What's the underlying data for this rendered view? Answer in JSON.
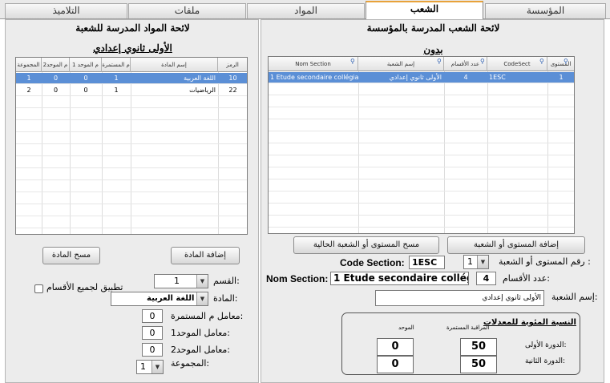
{
  "tabs": [
    {
      "label": "المؤسسة",
      "active": false
    },
    {
      "label": "الشعب",
      "active": true
    },
    {
      "label": "المواد",
      "active": false
    },
    {
      "label": "ملفات",
      "active": false
    },
    {
      "label": "التلاميذ",
      "active": false
    }
  ],
  "sections_panel": {
    "title": "لائحة الشعب المدرسة بالمؤسسة",
    "subtitle": "بدون",
    "columns": [
      "المستوى",
      "CodeSect",
      "عدد الأقسام",
      "إسم الشعبة",
      "Nom Section"
    ],
    "rows": [
      {
        "level": "1",
        "code": "1ESC",
        "count": "4",
        "name_ar": "الأولى ثانوي إعدادي",
        "name_fr": "1 Etude secondaire collégial"
      }
    ],
    "add_button": "إضافة المستوى أو الشعبة",
    "delete_button": "مسح المستوى أو الشعبة الحالية",
    "code_section_label": "Code Section:",
    "code_section_value": "1ESC",
    "level_label": "رقم المستوى أو الشعبة :",
    "level_value": "1",
    "nom_section_label": "Nom Section:",
    "nom_section_value": "1 Etude secondaire collégial",
    "classes_label": "عدد الأقسام:",
    "classes_value": "4",
    "name_label": "إسم الشعبة:",
    "name_value": "الأولى ثانوي إعدادي",
    "ratio_group": {
      "title": "النسبة المئوية للمعدلات",
      "col_continuous": "المراقبة المستمرة",
      "col_unified": "الموحد",
      "sem1_label": "الدورة الأولى:",
      "sem2_label": "الدورة الثانية:",
      "sem1_continuous": "50",
      "sem1_unified": "0",
      "sem2_continuous": "50",
      "sem2_unified": "0"
    }
  },
  "subjects_panel": {
    "title": "لائحة المواد المدرسة للشعبة",
    "subtitle": "الأولى ثانوي إعدادي",
    "columns": [
      "الرمز",
      "إسم المادة",
      "م المستمرة",
      "م الموحد 1",
      "م الموحد2",
      "المجموعة"
    ],
    "rows": [
      {
        "code": "10",
        "name": "اللغة العربية",
        "c1": "1",
        "c2": "0",
        "c3": "0",
        "group": "1"
      },
      {
        "code": "22",
        "name": "الرياضيات",
        "c1": "1",
        "c2": "0",
        "c3": "0",
        "group": "2"
      }
    ],
    "add_button": "إضافة المادة",
    "delete_button": "مسح المادة",
    "class_label": "القسم:",
    "class_value": "1",
    "apply_label": "تطبيق لجميع الأقسام",
    "subject_label": "المادة:",
    "subject_value": "اللغة العربية",
    "coef_continuous_label": "معامل م المستمرة:",
    "coef_continuous_value": "0",
    "coef_unified1_label": "معامل الموحد1:",
    "coef_unified1_value": "0",
    "coef_unified2_label": "معامل الموحد2:",
    "coef_unified2_value": "0",
    "group_label": "المجموعة:",
    "group_value": "1"
  },
  "colors": {
    "selected_row": "#5b8fd6",
    "active_tab_accent": "#e8a23a",
    "panel_bg": "#ececec"
  }
}
